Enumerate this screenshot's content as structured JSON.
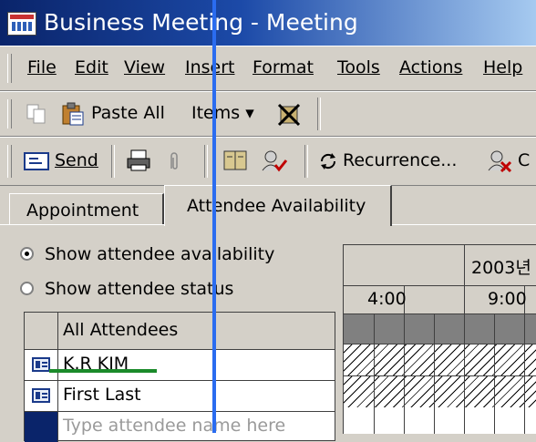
{
  "window": {
    "title": "Business Meeting - Meeting"
  },
  "menu": [
    "File",
    "Edit",
    "View",
    "Insert",
    "Format",
    "Tools",
    "Actions",
    "Help"
  ],
  "toolbar1": {
    "paste_all": "Paste All",
    "items": "Items ▾"
  },
  "toolbar2": {
    "send": "Send",
    "recurrence": "Recurrence...",
    "cancel_partial": "C"
  },
  "tabs": [
    "Appointment",
    "Attendee Availability"
  ],
  "options": {
    "show_availability": "Show attendee availability",
    "show_status": "Show attendee status",
    "selected": "show_availability"
  },
  "attendees": {
    "header": "All Attendees",
    "rows": [
      "K.R KIM",
      "First Last"
    ],
    "placeholder": "Type attendee name here"
  },
  "schedule": {
    "date_label": "2003년",
    "times": [
      "4:00",
      "9:00"
    ]
  },
  "colors": {
    "title_start": "#0a246a",
    "cursor_line": "#2a6cf0",
    "underline": "#1b8a2a"
  }
}
